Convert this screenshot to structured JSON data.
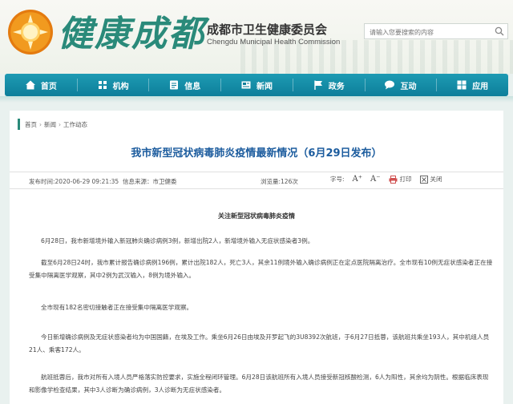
{
  "header": {
    "brand_calligraphy": "健康成都",
    "org_name": "成都市卫生健康委员会",
    "org_name_en": "Chengdu Municipal Health Commission",
    "search_placeholder": "请输入您要搜索的内容"
  },
  "nav": {
    "items": [
      {
        "label": "首页",
        "icon": "home-icon"
      },
      {
        "label": "机构",
        "icon": "building-icon"
      },
      {
        "label": "信息",
        "icon": "info-icon"
      },
      {
        "label": "新闻",
        "icon": "news-icon"
      },
      {
        "label": "政务",
        "icon": "flag-icon"
      },
      {
        "label": "互动",
        "icon": "chat-icon"
      },
      {
        "label": "应用",
        "icon": "apps-icon"
      }
    ]
  },
  "breadcrumb": [
    "首页",
    "新闻",
    "工作动态"
  ],
  "article": {
    "title": "我市新型冠状病毒肺炎疫情最新情况（6月29日发布）",
    "publish_time": "发布时间:2020-06-29 09:21:35",
    "source": "信息来源：市卫健委",
    "views": "浏览量:126次",
    "font_size_label": "字号:",
    "print_label": "打印",
    "close_label": "关闭",
    "subtitle": "关注新型冠状病毒肺炎疫情",
    "paragraphs": [
      "6月28日，我市新增境外输入新冠肺炎确诊病例3例，新增出院2人，新增境外输入无症状感染者3例。",
      "截至6月28日24时，我市累计报告确诊病例196例，累计出院182人，死亡3人，其余11例境外输入确诊病例正在定点医院隔离治疗。全市现有10例无症状感染者正在接受集中隔离医学观察，其中2例为武汉输入，8例为境外输入。",
      "全市现有182名密切接触者正在接受集中隔离医学观察。",
      "今日新增确诊病例及无症状感染者均为中国国籍，在埃及工作。乘坐6月26日由埃及开罗起飞的3U8392次航班，于6月27日抵蓉，该航班共乘坐193人，其中机组人员21人、乘客172人。",
      "航班抵蓉后，我市对所有入境人员严格落实防控要求，实施全程闭环管理。6月28日该航班所有入境人员接受新冠核酸检测，6人为阳性，其余均为阴性。根据临床表现和影像学检查结果，其中3人诊断为确诊病例，3人诊断为无症状感染者。"
    ]
  }
}
